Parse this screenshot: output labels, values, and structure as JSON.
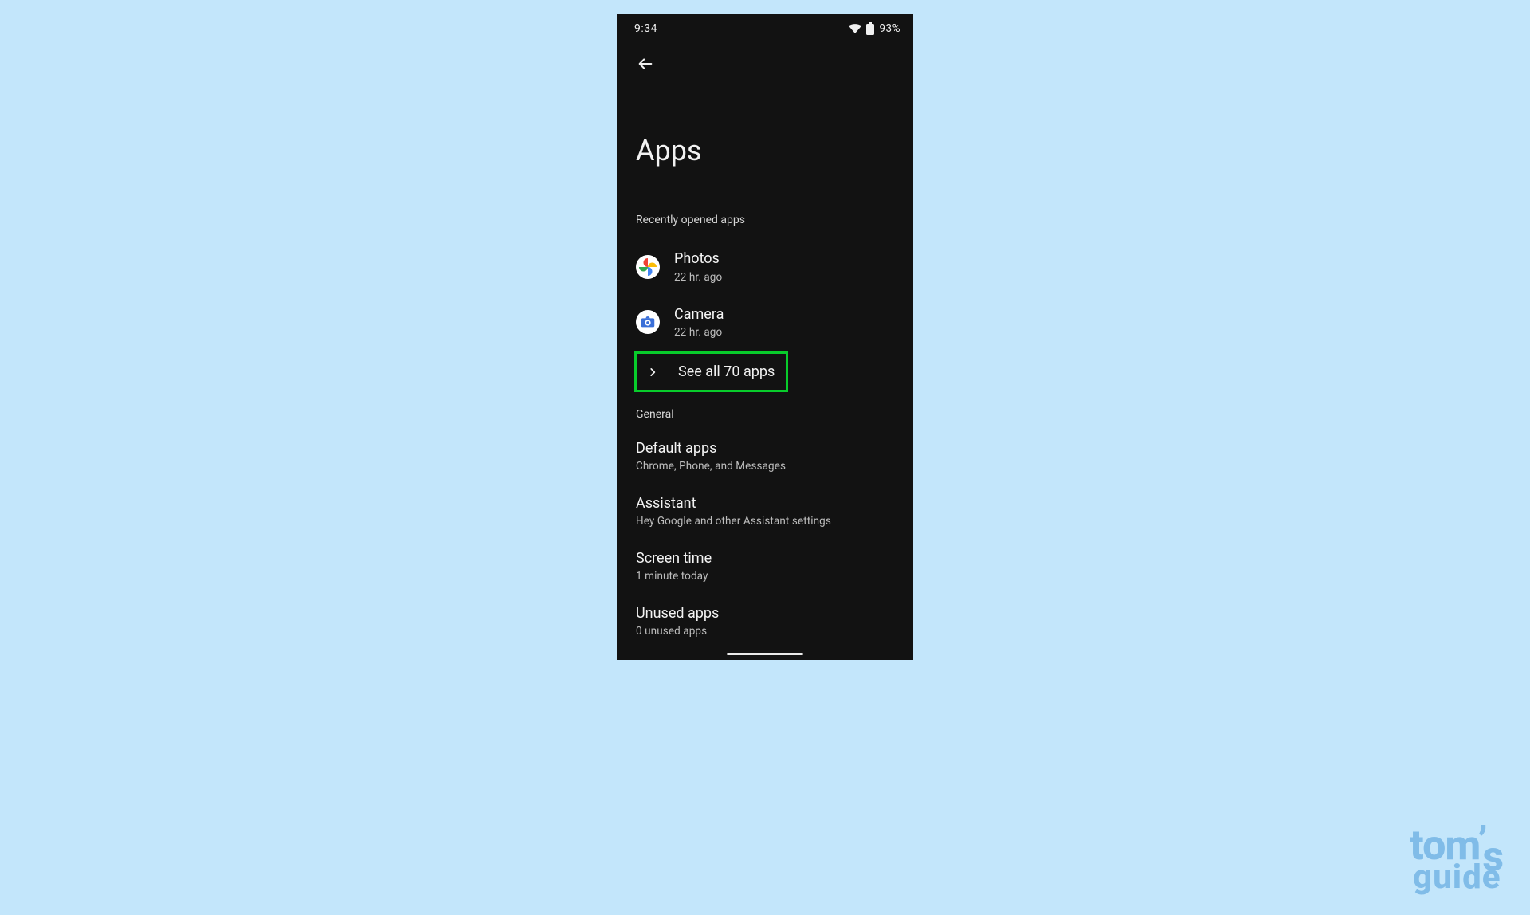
{
  "status": {
    "time": "9:34",
    "battery_pct": "93%"
  },
  "page": {
    "title": "Apps"
  },
  "sections": {
    "recent": {
      "label": "Recently opened apps",
      "items": [
        {
          "name": "Photos",
          "sub": "22 hr. ago"
        },
        {
          "name": "Camera",
          "sub": "22 hr. ago"
        }
      ],
      "see_all": "See all 70 apps"
    },
    "general": {
      "label": "General",
      "items": [
        {
          "name": "Default apps",
          "sub": "Chrome, Phone, and Messages"
        },
        {
          "name": "Assistant",
          "sub": "Hey Google and other Assistant settings"
        },
        {
          "name": "Screen time",
          "sub": "1 minute today"
        },
        {
          "name": "Unused apps",
          "sub": "0 unused apps"
        }
      ]
    }
  },
  "watermark": {
    "line1_a": "tom",
    "line1_apos": "’",
    "line1_s": "s",
    "line2": "guide"
  }
}
